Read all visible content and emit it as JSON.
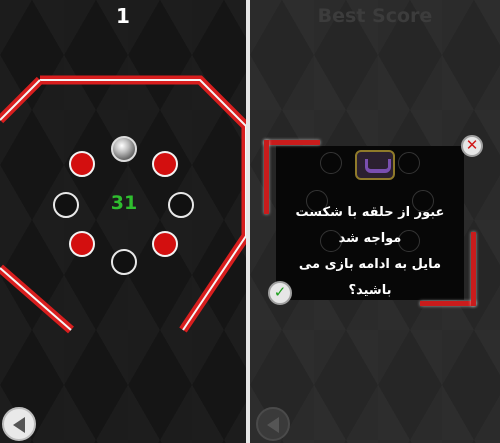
{
  "game": {
    "score": "1",
    "countdown": "31",
    "ball_icon": "ball-icon",
    "pegs": [
      {
        "id": "peg-red-top-left",
        "state": "red"
      },
      {
        "id": "peg-red-top-right",
        "state": "red"
      },
      {
        "id": "peg-empty-left",
        "state": "empty"
      },
      {
        "id": "peg-empty-right",
        "state": "empty"
      },
      {
        "id": "peg-red-bottom-left",
        "state": "red"
      },
      {
        "id": "peg-red-bottom-right",
        "state": "red"
      },
      {
        "id": "peg-empty-bottom",
        "state": "empty"
      }
    ],
    "colors": {
      "ring": "#d81e1e",
      "peg_red": "#d30f0f",
      "countdown": "#2fbe2f"
    }
  },
  "overlay": {
    "best_score_label": "Best Score",
    "dialog": {
      "line1": "عبور از حلقه با شکست مواجه شد",
      "line2": "مایل به ادامه بازی می باشید؟",
      "close_icon": "close-icon",
      "confirm_icon": "check-icon",
      "logo_icon": "app-logo-icon",
      "close_glyph": "✕",
      "confirm_glyph": "✓"
    }
  },
  "navigation": {
    "back_icon": "back-arrow-icon"
  }
}
